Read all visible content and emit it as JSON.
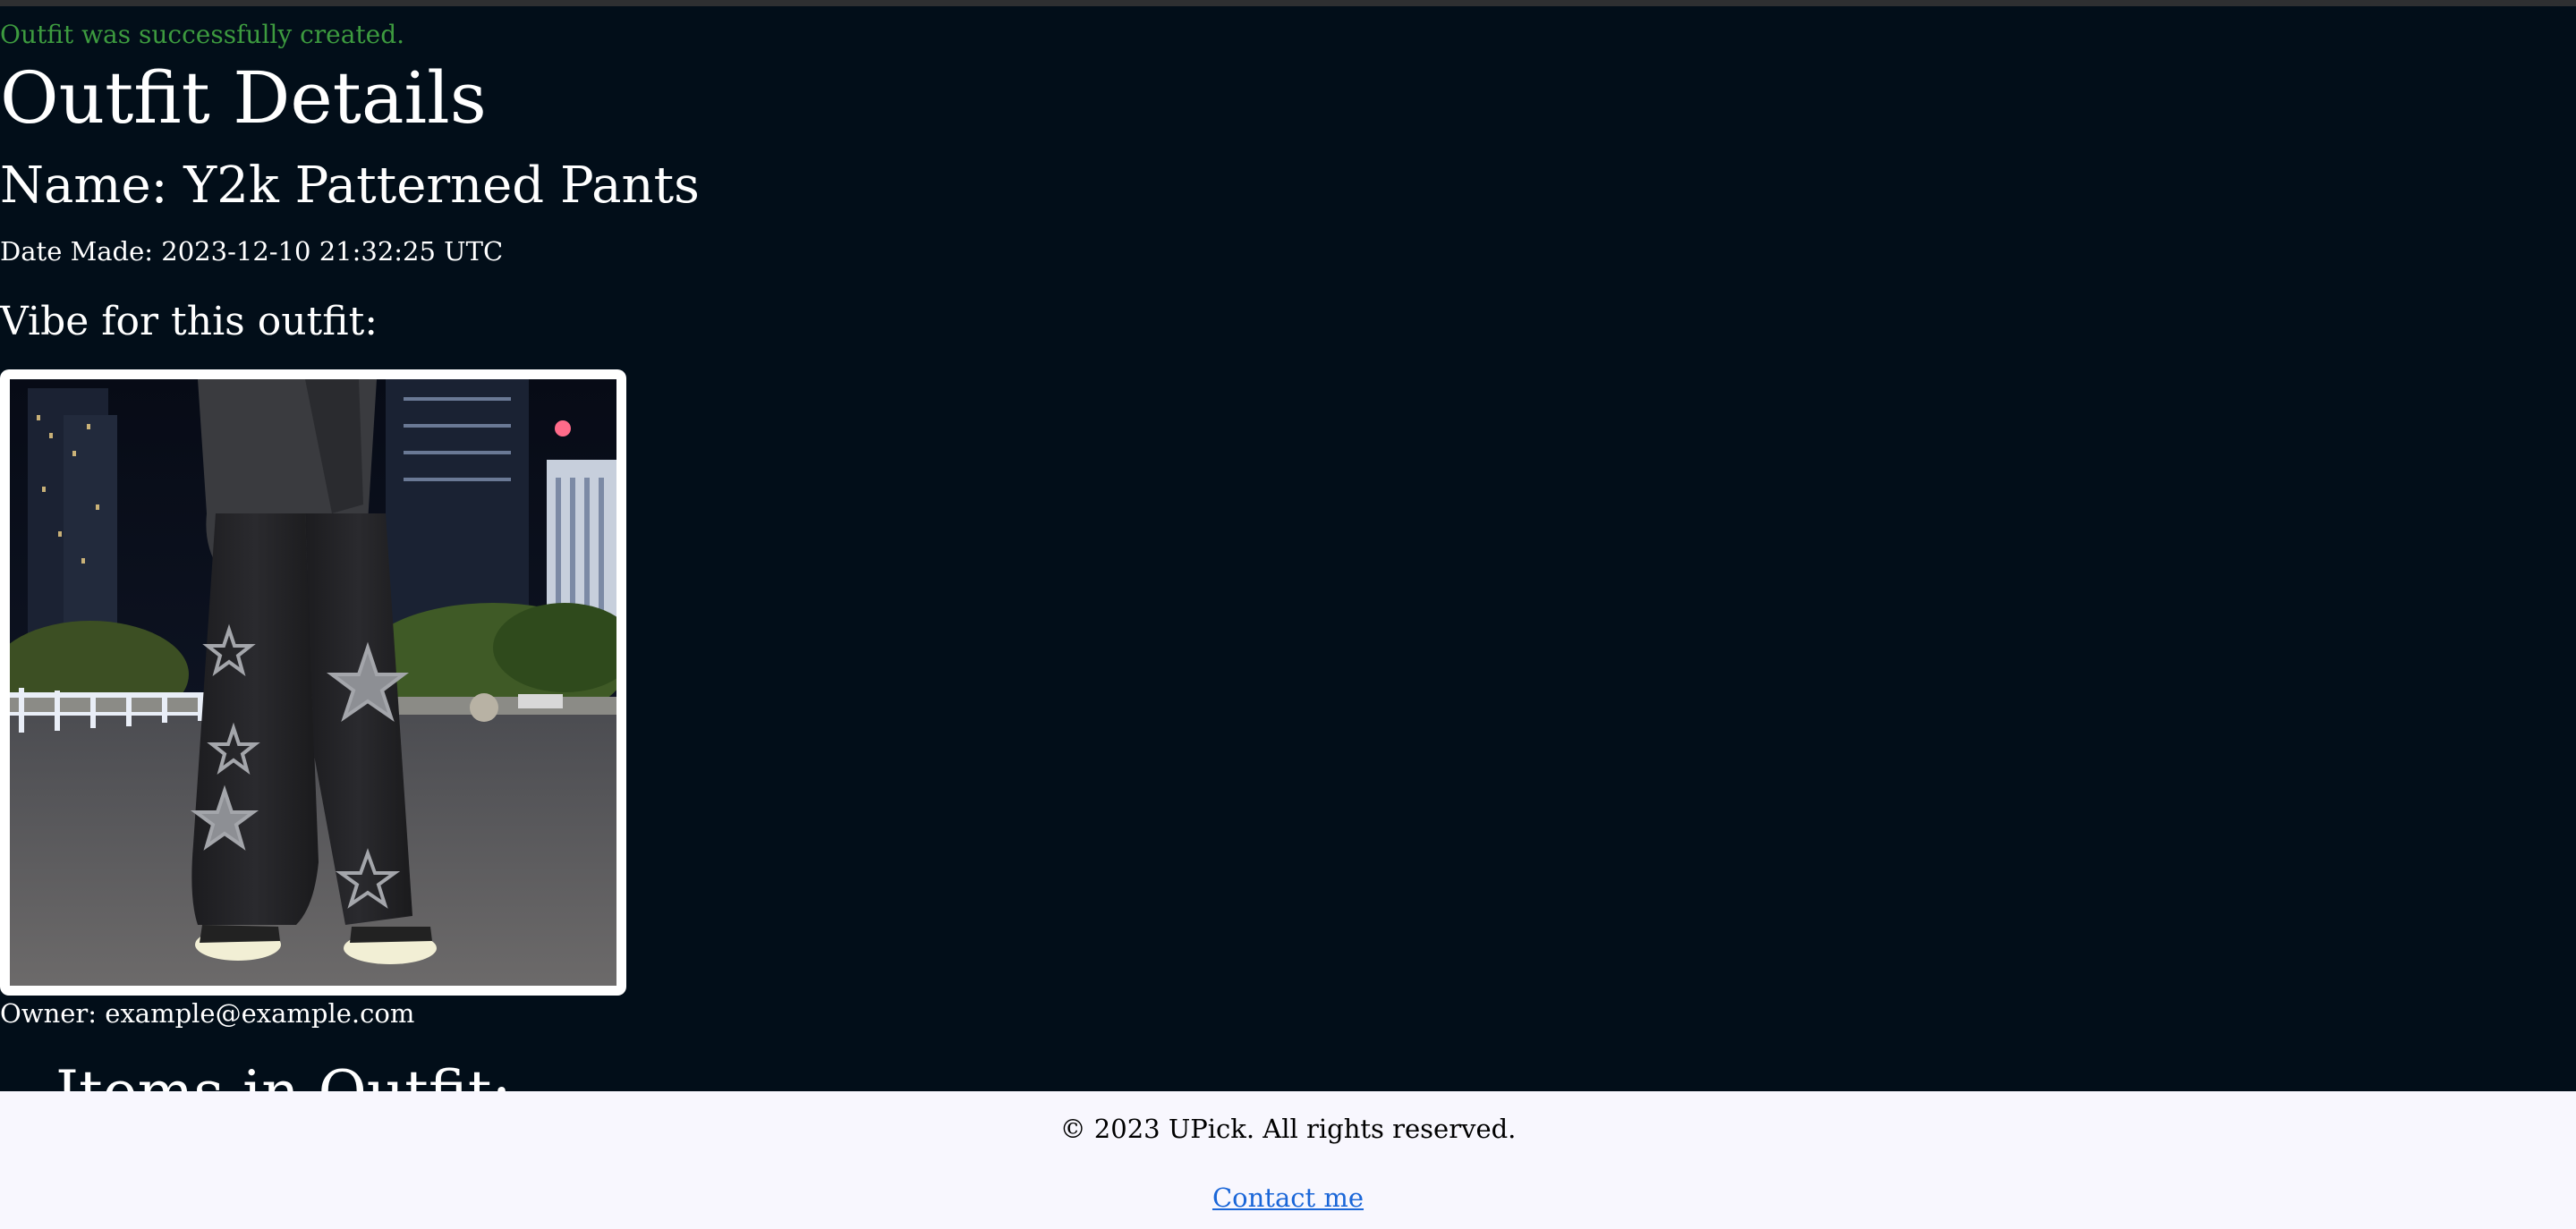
{
  "flash": {
    "notice": "Outfit was successfully created."
  },
  "outfit": {
    "heading": "Outfit Details",
    "name_text": "Name: Y2k Patterned Pants",
    "date_text": "Date Made: 2023-12-10 21:32:25 UTC",
    "vibe_heading": "Vibe for this outfit:",
    "owner_text": "Owner: example@example.com",
    "items_heading": "Items in Outfit:"
  },
  "footer": {
    "copyright": "© 2023 UPick. All rights reserved.",
    "contact_label": "Contact me"
  },
  "colors": {
    "page_background": "#020e19",
    "notice": "#3d9b3f",
    "footer_background": "#f8f7fe",
    "link": "#1a66d8"
  }
}
